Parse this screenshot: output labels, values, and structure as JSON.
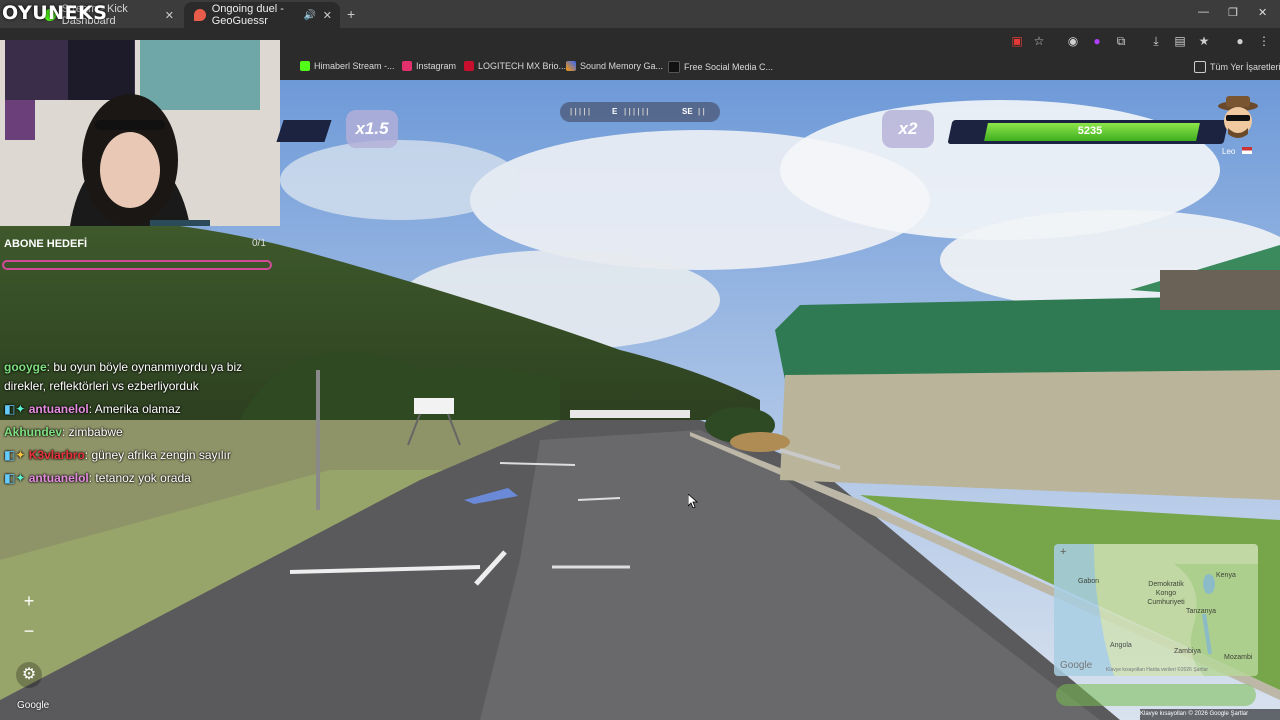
{
  "browser": {
    "tabs": [
      {
        "title": "Stream - Kick Dashboard"
      },
      {
        "title": "Ongoing duel - GeoGuessr"
      }
    ],
    "window_controls": {
      "minimize": "—",
      "maximize": "❐",
      "close": "✕"
    },
    "bookmarks": [
      {
        "label": "Himaberl Stream -...",
        "color": "#53fc18"
      },
      {
        "label": "Instagram",
        "color": "#e1306c"
      },
      {
        "label": "LOGITECH MX Brio...",
        "color": "#c8102e"
      },
      {
        "label": "Sound Memory Ga...",
        "color": "#9b59b6"
      },
      {
        "label": "Free Social Media C...",
        "color": "#111111"
      }
    ],
    "all_bookmarks": "Tüm Yer İşaretleri"
  },
  "overlay": {
    "brand": "OYUNEKS",
    "goal_title": "ABONE HEDEFİ",
    "goal_count": "0/1",
    "chat": [
      {
        "user": "gooyge",
        "user_color": "#7fe07f",
        "message": ": bu oyun böyle oynanmıyordu ya biz direkler, reflektörleri vs ezberliyorduk"
      },
      {
        "user": "antuanelol",
        "user_color": "#e58ce0",
        "message": ": Amerika olamaz"
      },
      {
        "user": "Akhundev",
        "user_color": "#7fe07f",
        "message": ": zimbabwe"
      },
      {
        "user": "K3vlarbro",
        "user_color": "#e8333a",
        "message": ": güney afrika zengin sayılır"
      },
      {
        "user": "antuanelol",
        "user_color": "#e58ce0",
        "message": ": tetanoz yok orada"
      }
    ]
  },
  "game": {
    "left_multiplier": "x1.5",
    "right_multiplier": "x2",
    "compass": {
      "e": "E",
      "se": "SE"
    },
    "opponent_health": "5235",
    "opponent_health_fraction": 0.9,
    "opponent_name": "Leo",
    "zoom_in": "+",
    "zoom_out": "−",
    "settings_icon": "gear-icon",
    "google_logo": "Google",
    "minimap_labels": [
      "Gabon",
      "Demokratik Kongo Cumhuriyeti",
      "Kenya",
      "Tanzanya",
      "Angola",
      "Zambiya",
      "Mozambi"
    ],
    "minimap_zoom": "+",
    "minimap_footer": "Klavye kısayolları   Harita verileri ©2026   Şartlar",
    "guess_button": "",
    "footer": "Klavye kısayolları  © 2026 Google  Şartlar"
  }
}
